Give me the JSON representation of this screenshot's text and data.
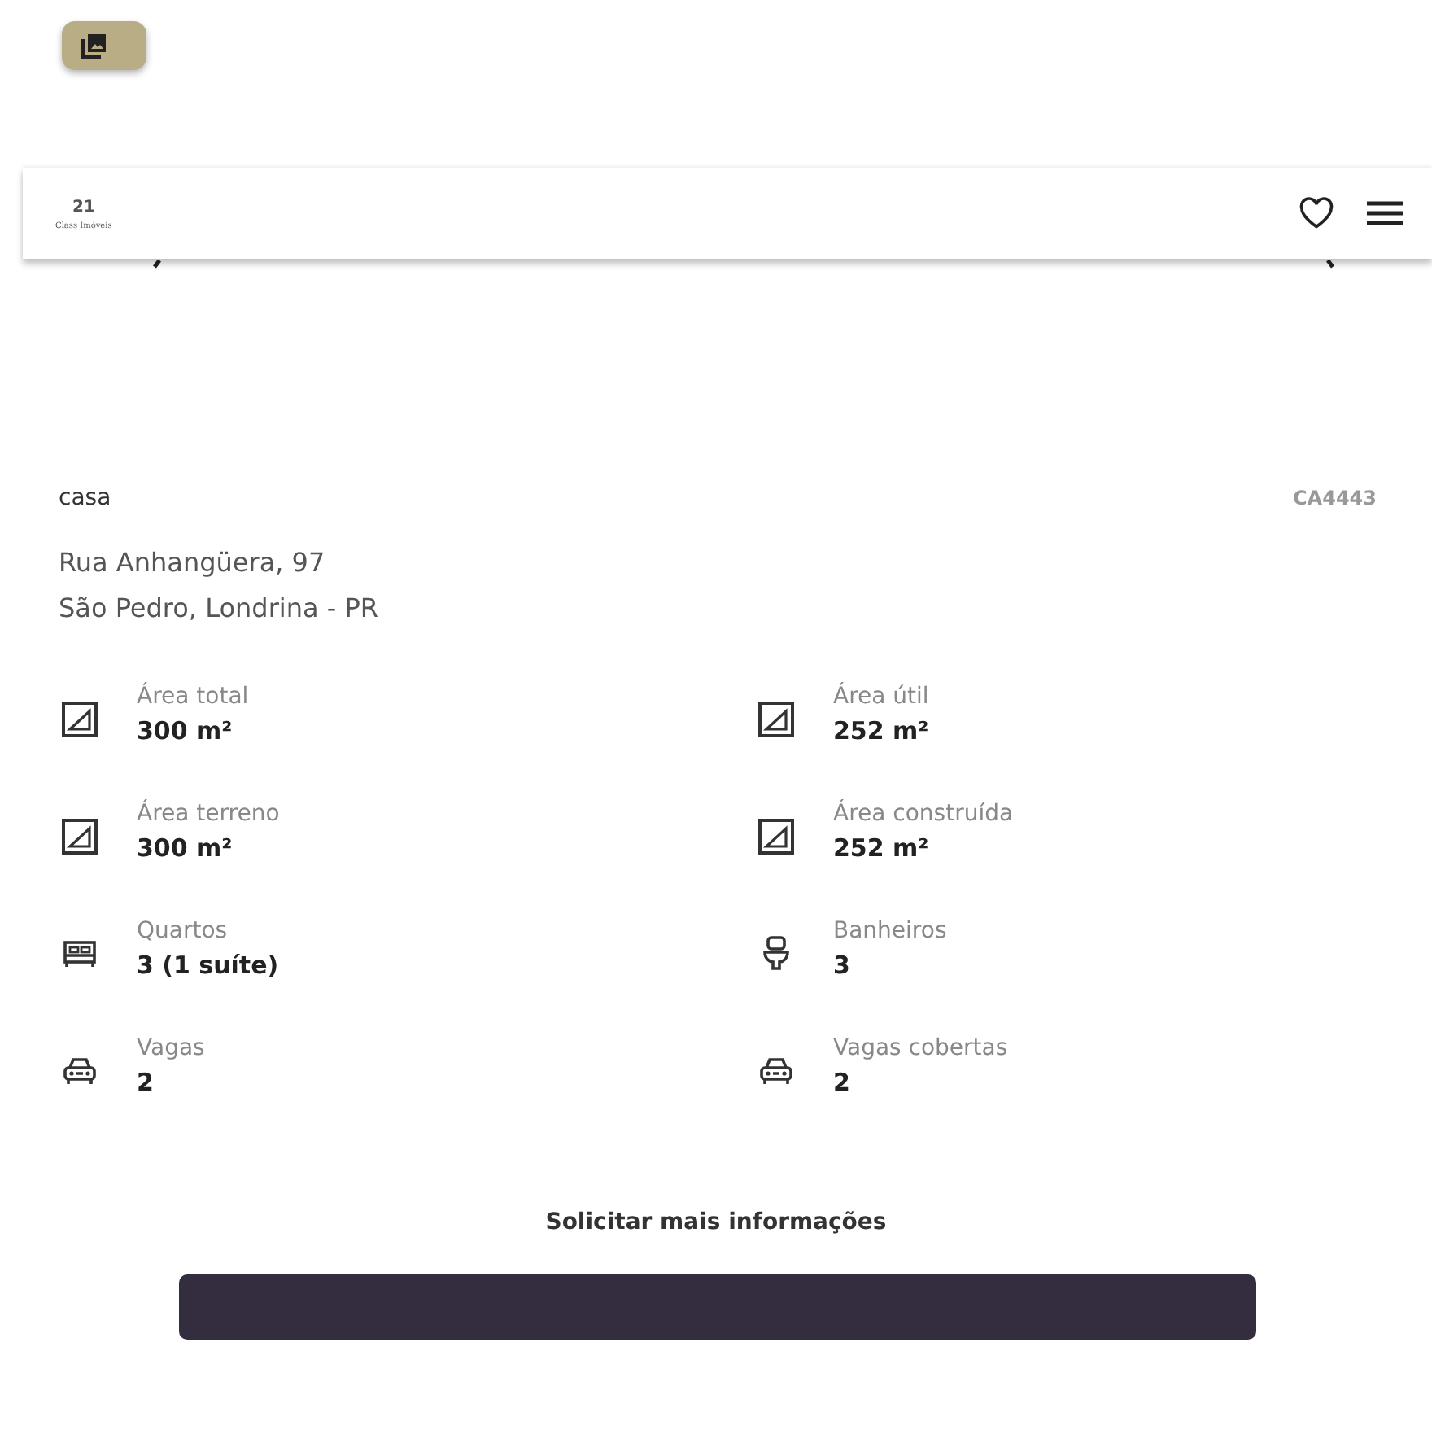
{
  "header": {
    "logo": {
      "mark": "21",
      "name": "Class Imóveis"
    }
  },
  "listing": {
    "type": "casa",
    "code": "CA4443",
    "address": [
      "Rua Anhangüera, 97",
      "São Pedro, Londrina - PR"
    ]
  },
  "features": [
    {
      "kind": "area",
      "label": "Área total",
      "value": "300 m²"
    },
    {
      "kind": "area",
      "label": "Área útil",
      "value": "252 m²"
    },
    {
      "kind": "area",
      "label": "Área terreno",
      "value": "300 m²"
    },
    {
      "kind": "area",
      "label": "Área construída",
      "value": "252 m²"
    },
    {
      "kind": "bed",
      "label": "Quartos",
      "value": "3 (1 suíte)"
    },
    {
      "kind": "toilet",
      "label": "Banheiros",
      "value": "3"
    },
    {
      "kind": "car",
      "label": "Vagas",
      "value": "2"
    },
    {
      "kind": "car",
      "label": "Vagas cobertas",
      "value": "2"
    }
  ],
  "contact": {
    "title": "Solicitar mais informações"
  }
}
